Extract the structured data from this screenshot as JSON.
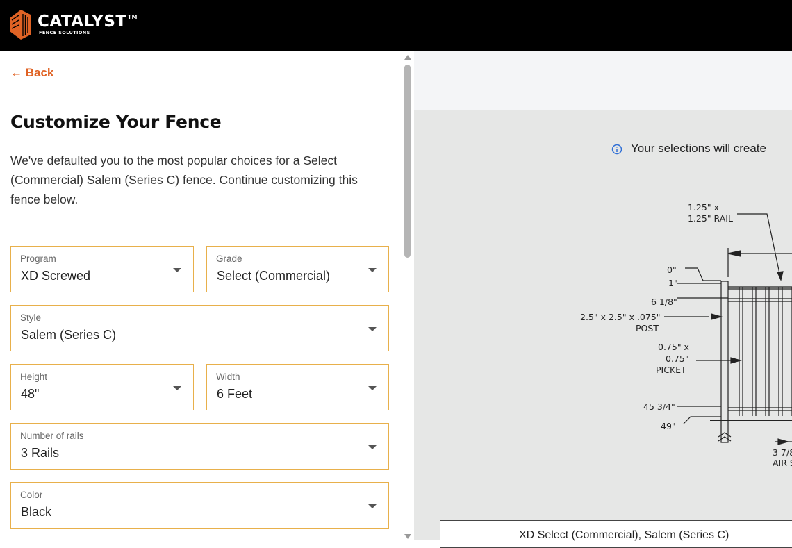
{
  "header": {
    "brand": "CATALYST",
    "trademark": "TM",
    "subtitle": "FENCE SOLUTIONS",
    "brand_color": "#e06325"
  },
  "nav": {
    "back_label": "Back"
  },
  "page": {
    "title": "Customize Your Fence",
    "intro": "We've defaulted you to the most popular choices for a Select (Commercial) Salem (Series C) fence. Continue customizing this fence below."
  },
  "fields": {
    "program": {
      "label": "Program",
      "value": "XD Screwed"
    },
    "grade": {
      "label": "Grade",
      "value": "Select (Commercial)"
    },
    "style": {
      "label": "Style",
      "value": "Salem (Series C)"
    },
    "height": {
      "label": "Height",
      "value": "48\""
    },
    "width": {
      "label": "Width",
      "value": "6 Feet"
    },
    "rails": {
      "label": "Number of rails",
      "value": "3 Rails"
    },
    "color": {
      "label": "Color",
      "value": "Black"
    }
  },
  "preview": {
    "notice": "Your selections will create",
    "caption": "XD Select (Commercial), Salem (Series C)",
    "drawing_labels": {
      "rail_a": "1.25\" x",
      "rail_b": "1.25\" RAIL",
      "d0": "0\"",
      "d1": "1\"",
      "d2": "6 1/8\"",
      "post_a": "2.5\" x 2.5\" x .075\"",
      "post_b": "POST",
      "picket_a": "0.75\" x",
      "picket_b": "0.75\"",
      "picket_c": "PICKET",
      "d3": "45 3/4\"",
      "d4": "49\"",
      "air_a": "3 7/8",
      "air_b": "AIR S"
    }
  },
  "colors": {
    "field_border": "#e8b04b",
    "accent": "#e06325",
    "preview_bg": "#e6e7e6"
  }
}
